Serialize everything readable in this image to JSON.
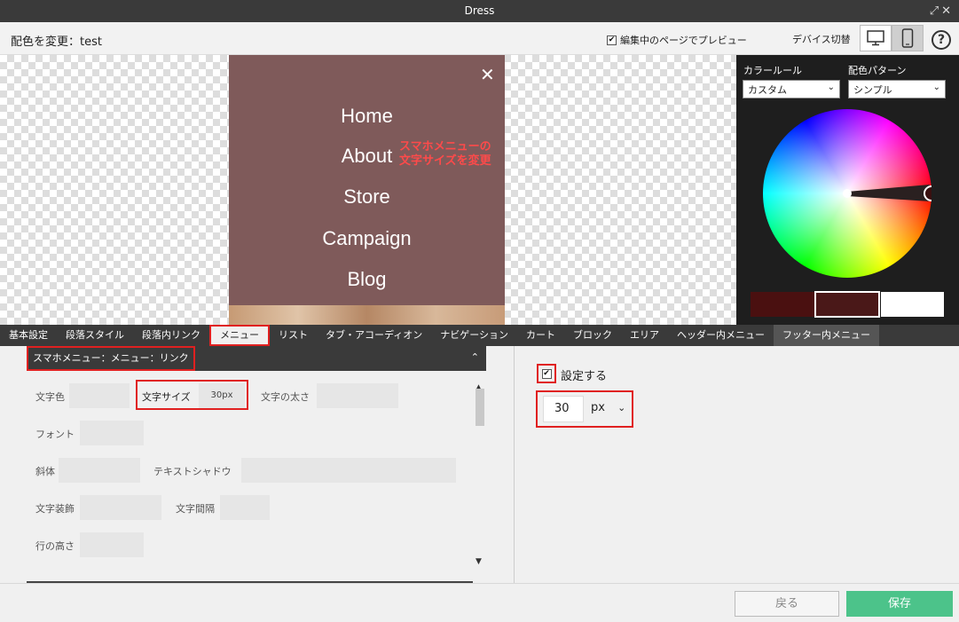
{
  "window": {
    "title": "Dress",
    "controls": "⤢✕"
  },
  "header": {
    "title": "配色を変更：test",
    "preview_label": "編集中のページでプレビュー",
    "device_label": "デバイス切替",
    "help": "?"
  },
  "preview": {
    "menu_links": [
      "Home",
      "About",
      "Store",
      "Campaign",
      "Blog"
    ],
    "close": "✕",
    "annotation_line1": "スマホメニューの",
    "annotation_line2": "文字サイズを変更"
  },
  "color_panel": {
    "rule_label": "カラールール",
    "rule_value": "カスタム",
    "pattern_label": "配色パターン",
    "pattern_value": "シンプル",
    "swatches": [
      "#4a1010",
      "#4a1818",
      "#ffffff"
    ]
  },
  "tabs": [
    "基本設定",
    "段落スタイル",
    "段落内リンク",
    "メニュー",
    "リスト",
    "タブ・アコーディオン",
    "ナビゲーション",
    "カート",
    "ブロック",
    "エリア",
    "ヘッダー内メニュー",
    "フッター内メニュー"
  ],
  "section": {
    "title": "スマホメニュー：メニュー：リンク",
    "toggle": "⌃",
    "props": {
      "text_color": "文字色",
      "font_size": "文字サイズ",
      "font_size_value": "30px",
      "font_weight": "文字の太さ",
      "font": "フォント",
      "italic": "斜体",
      "text_shadow": "テキストシャドウ",
      "decoration": "文字装飾",
      "letter_spacing": "文字間隔",
      "line_height": "行の高さ"
    }
  },
  "setting": {
    "enable_label": "設定する",
    "value": "30",
    "unit": "px"
  },
  "footer": {
    "back": "戻る",
    "save": "保存"
  }
}
